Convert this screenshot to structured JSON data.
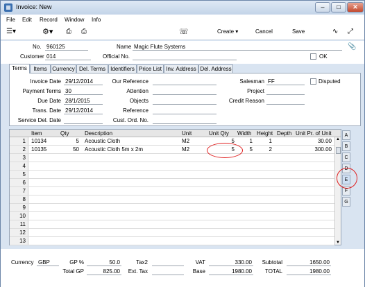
{
  "window": {
    "title": "Invoice: New"
  },
  "menu": [
    "File",
    "Edit",
    "Record",
    "Window",
    "Info"
  ],
  "toolbar": {
    "create": "Create",
    "cancel": "Cancel",
    "save": "Save"
  },
  "header": {
    "no_label": "No.",
    "no_value": "960125",
    "name_label": "Name",
    "name_value": "Magic Flute Systems",
    "customer_label": "Customer",
    "customer_value": "014",
    "official_label": "Official No.",
    "official_value": "",
    "ok_label": "OK"
  },
  "tabs": [
    "Terms",
    "Items",
    "Currency",
    "Del. Terms",
    "Identifiers",
    "Price List",
    "Inv. Address",
    "Del. Address"
  ],
  "terms": {
    "invoice_date_label": "Invoice Date",
    "invoice_date": "29/12/2014",
    "payment_terms_label": "Payment Terms",
    "payment_terms": "30",
    "due_date_label": "Due Date",
    "due_date": "28/1/2015",
    "trans_date_label": "Trans. Date",
    "trans_date": "29/12/2014",
    "service_del_date_label": "Service Del. Date",
    "service_del_date": "",
    "our_reference_label": "Our Reference",
    "attention_label": "Attention",
    "objects_label": "Objects",
    "reference_label": "Reference",
    "cust_ord_label": "Cust. Ord. No.",
    "salesman_label": "Salesman",
    "salesman": "FF",
    "disputed_label": "Disputed",
    "project_label": "Project",
    "credit_reason_label": "Credit Reason"
  },
  "grid": {
    "columns": [
      "Item",
      "Qty",
      "Description",
      "Unit",
      "Unit Qty",
      "Width",
      "Height",
      "Depth",
      "Unit Pr. of Unit"
    ],
    "rows": [
      {
        "num": "1",
        "item": "10134",
        "qty": "5",
        "desc": "Acoustic Cloth",
        "unit": "M2",
        "unit_qty": "5",
        "width": "1",
        "height": "1",
        "depth": "",
        "price": "30.00"
      },
      {
        "num": "2",
        "item": "10135",
        "qty": "50",
        "desc": "Acoustic Cloth 5m x 2m",
        "unit": "M2",
        "unit_qty": "5",
        "width": "5",
        "height": "2",
        "depth": "",
        "price": "300.00"
      },
      {
        "num": "3"
      },
      {
        "num": "4"
      },
      {
        "num": "5"
      },
      {
        "num": "6"
      },
      {
        "num": "7"
      },
      {
        "num": "8"
      },
      {
        "num": "9"
      },
      {
        "num": "10"
      },
      {
        "num": "11"
      },
      {
        "num": "12"
      },
      {
        "num": "13"
      }
    ],
    "side_tabs": [
      "A",
      "B",
      "C",
      "D",
      "E",
      "F",
      "G"
    ],
    "active_side_tab": "E"
  },
  "footer": {
    "currency_label": "Currency",
    "currency": "GBP",
    "gp_pct_label": "GP %",
    "gp_pct": "50.0",
    "total_gp_label": "Total GP",
    "total_gp": "825.00",
    "tax2_label": "Tax2",
    "tax2": "",
    "ext_tax_label": "Ext. Tax",
    "ext_tax": "",
    "vat_label": "VAT",
    "vat": "330.00",
    "base_label": "Base",
    "base": "1980.00",
    "subtotal_label": "Subtotal",
    "subtotal": "1650.00",
    "total_label": "TOTAL",
    "total": "1980.00"
  },
  "colors": {
    "window_bg": "#d9e4f1",
    "highlight": "#e02020"
  }
}
